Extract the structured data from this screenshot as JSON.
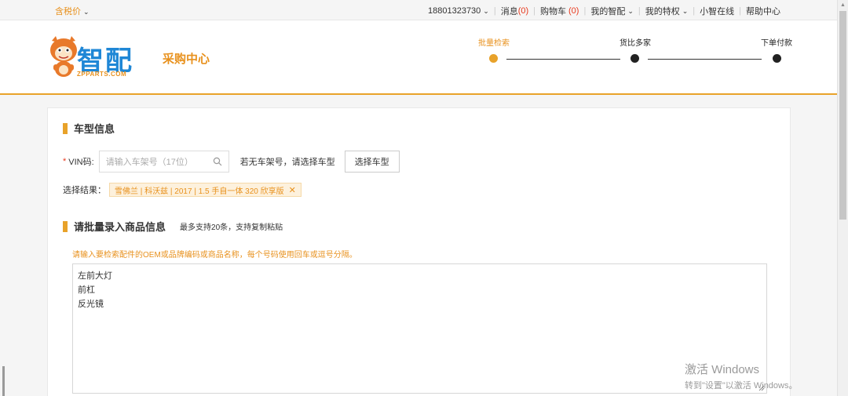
{
  "topbar": {
    "tax_label": "含税价",
    "links": [
      {
        "label": "18801323730",
        "chevron": true
      },
      {
        "label": "消息",
        "count": "(0)"
      },
      {
        "label": "购物车",
        "count": "(0)"
      },
      {
        "label": "我的智配",
        "chevron": true
      },
      {
        "label": "我的特权",
        "chevron": true
      },
      {
        "label": "小智在线"
      },
      {
        "label": "帮助中心"
      }
    ]
  },
  "header": {
    "logo_text": "智配",
    "logo_sub": "ZPPARTS.COM",
    "center_title": "采购中心",
    "steps": [
      {
        "label": "批量检索",
        "active": true
      },
      {
        "label": "货比多家",
        "active": false
      },
      {
        "label": "下单付款",
        "active": false
      }
    ]
  },
  "vehicle": {
    "title": "车型信息",
    "vin_label": "VIN码:",
    "vin_placeholder": "请输入车架号（17位）",
    "no_vin_text": "若无车架号，请选择车型",
    "select_button": "选择车型",
    "result_label": "选择结果：",
    "result_tag": "雪佛兰 | 科沃兹 | 2017 | 1.5 手自一体 320 欣享版"
  },
  "batch": {
    "title": "请批量录入商品信息",
    "hint": "最多支持20条，支持复制粘贴",
    "instruction": "请输入要检索配件的OEM或品牌编码或商品名称，每个号码使用回车或逗号分隔。",
    "entries": [
      "左前大灯",
      "前杠",
      "反光镜"
    ]
  },
  "watermark": {
    "line1": "激活 Windows",
    "line2": "转到\"设置\"以激活 Windows。"
  },
  "colors": {
    "accent": "#e8a22a",
    "brand_orange": "#e8911d",
    "brand_blue": "#1f87d6",
    "step_inactive": "#222222"
  }
}
